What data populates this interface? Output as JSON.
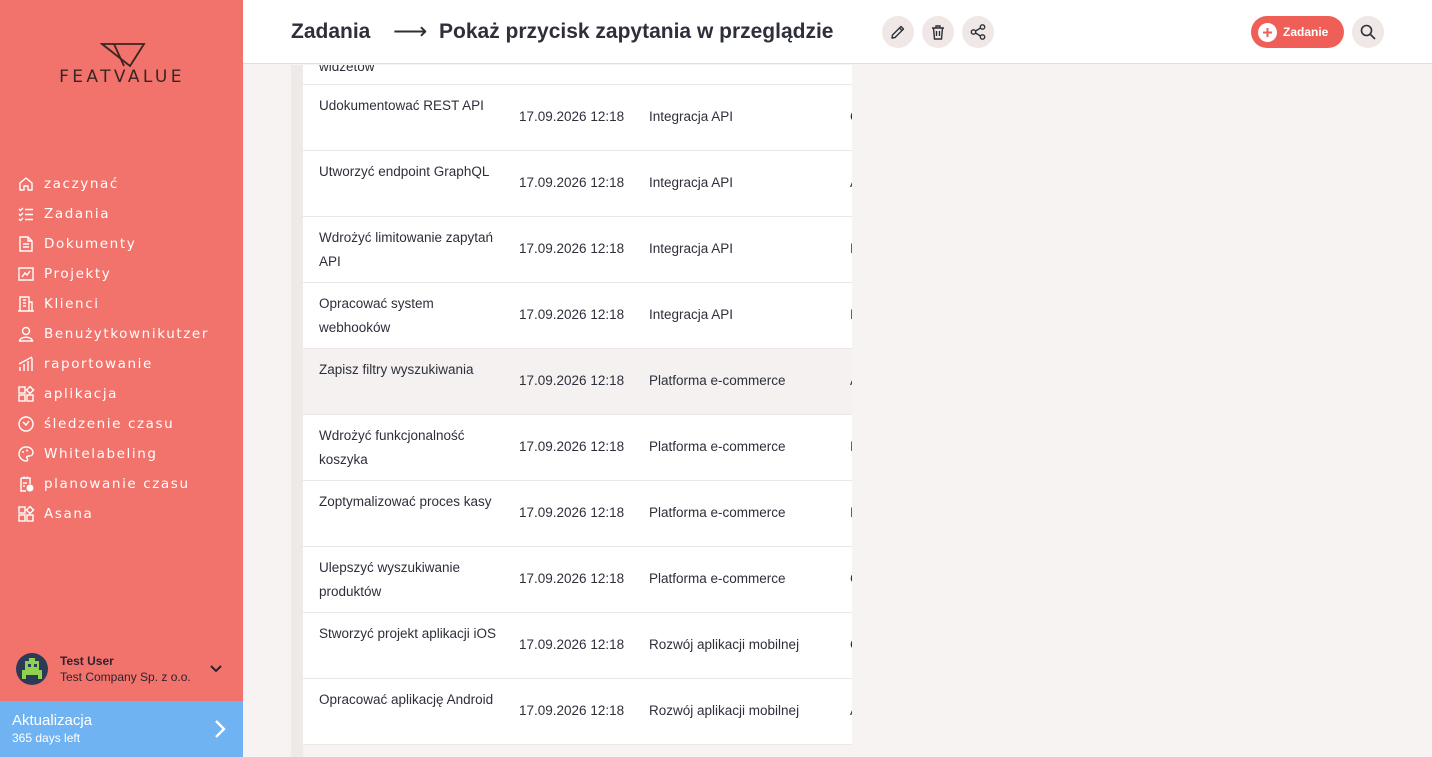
{
  "brand": {
    "logo_text": "FEATVALUE"
  },
  "sidebar": {
    "items": [
      {
        "label": "zaczynać",
        "icon": "home-icon"
      },
      {
        "label": "Zadania",
        "icon": "tasks-icon"
      },
      {
        "label": "Dokumenty",
        "icon": "documents-icon"
      },
      {
        "label": "Projekty",
        "icon": "projects-icon"
      },
      {
        "label": "Klienci",
        "icon": "clients-icon"
      },
      {
        "label": "Benużytkownikutzer",
        "icon": "user-icon"
      },
      {
        "label": "raportowanie",
        "icon": "reporting-icon"
      },
      {
        "label": "aplikacja",
        "icon": "apps-icon"
      },
      {
        "label": "śledzenie czasu",
        "icon": "time-tracking-icon"
      },
      {
        "label": "Whitelabeling",
        "icon": "palette-icon"
      },
      {
        "label": "planowanie czasu",
        "icon": "time-planning-icon"
      },
      {
        "label": "Asana",
        "icon": "asana-apps-icon"
      }
    ],
    "user": {
      "name": "Test User",
      "company": "Test Company Sp. z o.o."
    },
    "upgrade": {
      "title": "Aktualizacja",
      "subtitle": "365 days left"
    }
  },
  "header": {
    "breadcrumb_root": "Zadania",
    "breadcrumb_arrow": "⟶",
    "title": "Pokaż przycisk zapytania w przeglądzie",
    "add_label": "Zadanie"
  },
  "table": {
    "top_partial": "widżetów",
    "rows": [
      {
        "name": "Udokumentować REST API",
        "date": "17.09.2026 12:18",
        "project": "Integracja API",
        "edge": "C"
      },
      {
        "name": "Utworzyć endpoint GraphQL",
        "date": "17.09.2026 12:18",
        "project": "Integracja API",
        "edge": "A"
      },
      {
        "name": "Wdrożyć limitowanie zapytań API",
        "date": "17.09.2026 12:18",
        "project": "Integracja API",
        "edge": "I"
      },
      {
        "name": "Opracować system webhooków",
        "date": "17.09.2026 12:18",
        "project": "Integracja API",
        "edge": "I"
      },
      {
        "name": "Zapisz filtry wyszukiwania",
        "date": "17.09.2026 12:18",
        "project": "Platforma e-commerce",
        "edge": "A",
        "highlight": true
      },
      {
        "name": "Wdrożyć funkcjonalność koszyka",
        "date": "17.09.2026 12:18",
        "project": "Platforma e-commerce",
        "edge": "I"
      },
      {
        "name": "Zoptymalizować proces kasy",
        "date": "17.09.2026 12:18",
        "project": "Platforma e-commerce",
        "edge": "I"
      },
      {
        "name": "Ulepszyć wyszukiwanie produktów",
        "date": "17.09.2026 12:18",
        "project": "Platforma e-commerce",
        "edge": "C"
      },
      {
        "name": "Stworzyć projekt aplikacji iOS",
        "date": "17.09.2026 12:18",
        "project": "Rozwój aplikacji mobilnej",
        "edge": "C"
      },
      {
        "name": "Opracować aplikację Android",
        "date": "17.09.2026 12:18",
        "project": "Rozwój aplikacji mobilnej",
        "edge": "A"
      }
    ]
  },
  "colors": {
    "sidebar": "#f2736b",
    "accent": "#ef5f58",
    "upgrade": "#6fb3f2"
  }
}
